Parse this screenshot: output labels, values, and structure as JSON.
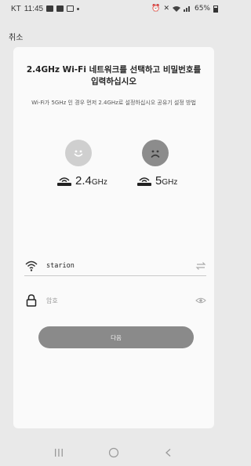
{
  "status_bar": {
    "carrier": "KT",
    "time": "11:45",
    "right_text": "65%"
  },
  "header": {
    "cancel_label": "취소"
  },
  "card": {
    "title": "2.4GHz Wi-Fi 네트워크를 선택하고 비밀번호를 입력하십시오",
    "subtitle": "Wi-Fi가 5GHz 인 경우 먼저 2.4GHz로 설정하십시오 공유기 설정 방법",
    "bands": [
      {
        "main": "2.4",
        "unit": "GHz",
        "status": "supported",
        "face_icon": "smile-icon"
      },
      {
        "main": "5",
        "unit": "GHz",
        "status": "unsupported",
        "face_icon": "sad-icon"
      }
    ],
    "ssid": {
      "value": "starion"
    },
    "password": {
      "placeholder": "암호"
    },
    "next_label": "다음"
  },
  "colors": {
    "background": "#e9e9e9",
    "card": "#fafafa",
    "button": "#8a8a8a",
    "face_happy": "#cfcfcf",
    "face_sad": "#8c8c8c"
  }
}
